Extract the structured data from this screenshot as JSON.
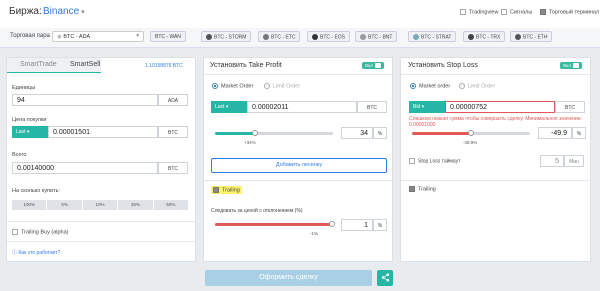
{
  "header": {
    "exchange_label": "Биржа:",
    "exchange_value": "Binance",
    "options": [
      {
        "label": "Tradingview",
        "checked": false
      },
      {
        "label": "Сигналы",
        "checked": false
      },
      {
        "label": "Торговый терминал",
        "checked": true
      }
    ]
  },
  "pairbar": {
    "label": "Торговая пара",
    "selected": "BTC - ADA",
    "chips": [
      "BTC - WAN",
      "BTC - STORM",
      "BTC - ETC",
      "BTC - EOS",
      "BTC - BNT",
      "BTC - STRAT",
      "BTC - TRX",
      "BTC - ETH"
    ]
  },
  "left": {
    "tab_trade": "SmartTrade",
    "tab_sell": "SmartSell",
    "balance": "1.10158876 BTC",
    "units_label": "Единицы",
    "units_value": "94",
    "units_unit": "ADA",
    "price_label": "Цена покупки",
    "price_mode": "Last",
    "price_value": "0.00001501",
    "price_unit": "BTC",
    "total_label": "Всего",
    "total_value": "0.00140000",
    "total_unit": "BTC",
    "split_label": "На сколько купить:",
    "splits": [
      "100%",
      "5%",
      "10%",
      "25%",
      "50%"
    ],
    "trailing_buy": "Trailing Buy (alpha)",
    "help_link": "Как это работает?"
  },
  "tp": {
    "title": "Установить Take Profit",
    "toggle": "Вкл",
    "market_order": "Market Order",
    "limit_order": "Limit Order",
    "mode": "Last",
    "price": "0.00002011",
    "unit": "BTC",
    "pct": "34",
    "pct_unit": "%",
    "slider_label": "+34%",
    "slider_fraction": 0.34,
    "add_button": "Добавить лесенку",
    "trailing": "Trailing",
    "follow_label": "Следовать за ценой с отклонением (%)",
    "deviation": "1",
    "deviation_unit": "%",
    "dev_slider_label": "-1%",
    "dev_slider_fraction": 0.99
  },
  "sl": {
    "title": "Установить Stop Loss",
    "toggle": "Вкл",
    "market_order": "Market order",
    "limit_order": "Limit Order",
    "mode": "Bid",
    "price": "0.00000752",
    "unit": "BTC",
    "error": "Слишком низкая сумма чтобы совершить сделку. Минимальное значение: 0.00001000",
    "pct": "-49.9",
    "pct_unit": "%",
    "slider_label": "-49.9%",
    "slider_fraction": 0.5,
    "timeout_label": "Stop Loss таймаут",
    "timeout_value": "5",
    "timeout_unit": "Мин",
    "trailing": "Trailing"
  },
  "footer": {
    "submit": "Оформить сделку",
    "share_icon": "share-icon"
  },
  "colors": {
    "accent": "#25b6a5",
    "danger": "#e05a5a",
    "link": "#2c7be5"
  }
}
